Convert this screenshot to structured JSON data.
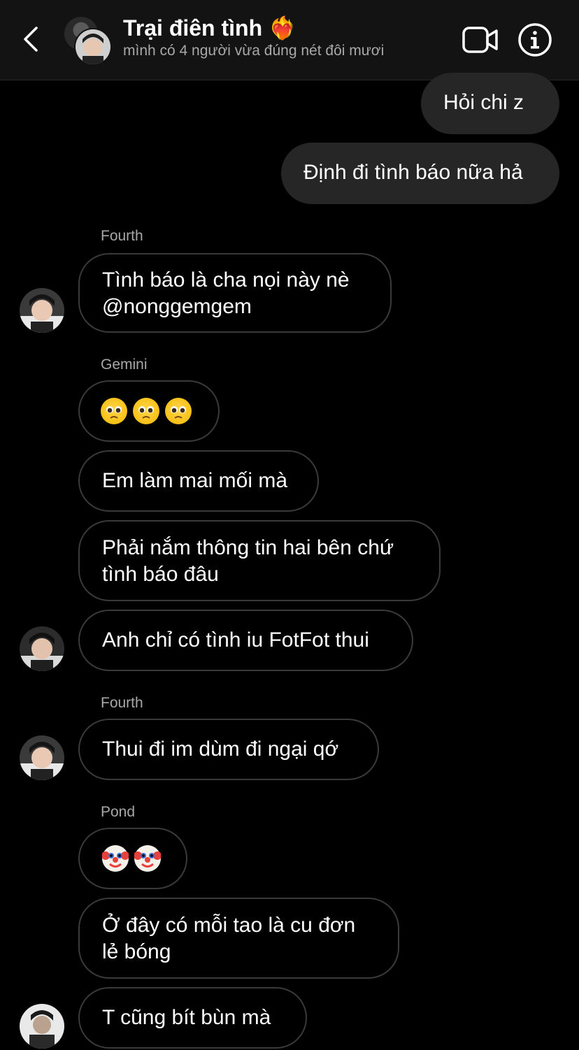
{
  "header": {
    "title": "Trại điên tình ❤️‍🔥",
    "subtitle": "mình có 4 người vừa đúng nét đôi mươi"
  },
  "messages": [
    {
      "type": "outgoing",
      "text": "Hỏi chi z"
    },
    {
      "type": "outgoing",
      "text": "Định đi tình báo nữa hả"
    },
    {
      "type": "incoming",
      "sender": "Fourth",
      "lines": [
        "Tình báo là cha nọi này nè",
        "@nonggemgem"
      ]
    },
    {
      "type": "incoming",
      "sender": "Gemini",
      "emoji": "pleading-face x3"
    },
    {
      "type": "incoming",
      "text": "Em làm mai mối mà"
    },
    {
      "type": "incoming",
      "lines": [
        "Phải nắm thông tin hai bên chứ",
        "tình báo đâu"
      ]
    },
    {
      "type": "incoming",
      "text": "Anh chỉ có tình iu FotFot thui"
    },
    {
      "type": "incoming",
      "sender": "Fourth",
      "text": "Thui đi im dùm đi ngại qớ"
    },
    {
      "type": "incoming",
      "sender": "Pond",
      "emoji": "clown-face x2"
    },
    {
      "type": "incoming",
      "lines": [
        "Ở đây có mỗi tao là cu đơn",
        "lẻ bóng"
      ]
    },
    {
      "type": "incoming",
      "text": "T cũng bít bùn mà"
    }
  ]
}
